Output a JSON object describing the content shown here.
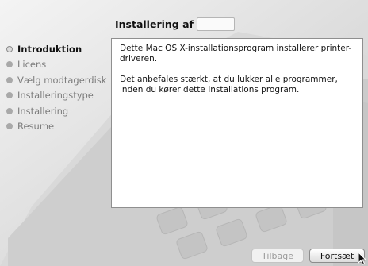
{
  "window": {
    "title": "Installering af",
    "title_field_value": ""
  },
  "steps": [
    {
      "label": "Introduktion",
      "state": "active"
    },
    {
      "label": "Licens",
      "state": "pending"
    },
    {
      "label": "Vælg modtagerdisk",
      "state": "pending"
    },
    {
      "label": "Installeringstype",
      "state": "pending"
    },
    {
      "label": "Installering",
      "state": "pending"
    },
    {
      "label": "Resume",
      "state": "pending"
    }
  ],
  "content": {
    "paragraphs": [
      "Dette Mac OS X-installationsprogram installerer printer-driveren.",
      "Det anbefales stærkt, at du lukker alle programmer, inden du kører dette Installations program."
    ]
  },
  "buttons": {
    "back_label": "Tilbage",
    "back_enabled": false,
    "continue_label": "Fortsæt",
    "continue_enabled": true
  },
  "colors": {
    "background": "#e6e6e6",
    "content_bg": "#ffffff",
    "active_text": "#111111",
    "inactive_text": "#7c7c7c"
  },
  "icons": {
    "step_marker": "circle-dot-icon",
    "pointer": "mouse-pointer-icon"
  }
}
